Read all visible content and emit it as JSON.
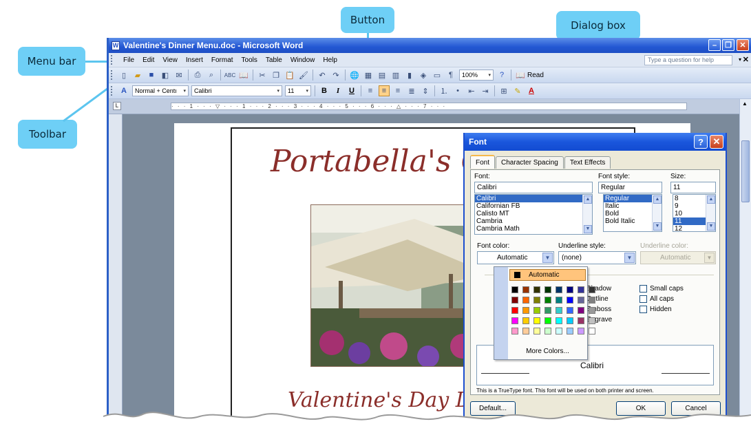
{
  "callouts": {
    "menu_bar": "Menu bar",
    "toolbar": "Toolbar",
    "button": "Button",
    "dialog_box": "Dialog box"
  },
  "window": {
    "title": "Valentine's Dinner Menu.doc - Microsoft Word",
    "minimize": "–",
    "restore": "❐",
    "close": "✕"
  },
  "menu": {
    "items": [
      "File",
      "Edit",
      "View",
      "Insert",
      "Format",
      "Tools",
      "Table",
      "Window",
      "Help"
    ],
    "help_placeholder": "Type a question for help"
  },
  "toolbar1": {
    "zoom": "100%",
    "read_label": "Read"
  },
  "toolbar2": {
    "style": "Normal + Centı",
    "font": "Calibri",
    "size": "11",
    "bold": "B",
    "italic": "I",
    "underline": "U"
  },
  "document": {
    "heading": "Portabella's Ga",
    "subheading": "Valentine's Day Di"
  },
  "dialog": {
    "title": "Font",
    "help": "?",
    "close": "✕",
    "tabs": [
      "Font",
      "Character Spacing",
      "Text Effects"
    ],
    "font_label": "Font:",
    "font_value": "Calibri",
    "font_list": [
      "Calibri",
      "Californian FB",
      "Calisto MT",
      "Cambria",
      "Cambria Math"
    ],
    "style_label": "Font style:",
    "style_value": "Regular",
    "style_list": [
      "Regular",
      "Italic",
      "Bold",
      "Bold Italic"
    ],
    "size_label": "Size:",
    "size_value": "11",
    "size_list": [
      "8",
      "9",
      "10",
      "11",
      "12"
    ],
    "font_color_label": "Font color:",
    "font_color_value": "Automatic",
    "underline_style_label": "Underline style:",
    "underline_style_value": "(none)",
    "underline_color_label": "Underline color:",
    "underline_color_value": "Automatic",
    "effects_col2": [
      "Shadow",
      "Outline",
      "Emboss",
      "Engrave"
    ],
    "effects_col3": [
      "Small caps",
      "All caps",
      "Hidden"
    ],
    "preview_text": "Calibri",
    "truetype_note": "This is a TrueType font. This font will be used on both printer and screen.",
    "default_button": "Default...",
    "ok_button": "OK",
    "cancel_button": "Cancel"
  },
  "palette": {
    "automatic": "Automatic",
    "more_colors": "More Colors...",
    "colors": [
      "#000000",
      "#993300",
      "#333300",
      "#003300",
      "#003366",
      "#000080",
      "#333399",
      "#333333",
      "#800000",
      "#ff6600",
      "#808000",
      "#008000",
      "#008080",
      "#0000ff",
      "#666699",
      "#808080",
      "#ff0000",
      "#ff9900",
      "#99cc00",
      "#339966",
      "#33cccc",
      "#3366ff",
      "#800080",
      "#999999",
      "#ff00ff",
      "#ffcc00",
      "#ffff00",
      "#00ff00",
      "#00ffff",
      "#00ccff",
      "#993366",
      "#c0c0c0",
      "#ff99cc",
      "#ffcc99",
      "#ffff99",
      "#ccffcc",
      "#ccffff",
      "#99ccff",
      "#cc99ff",
      "#ffffff"
    ]
  },
  "accent": "#6ecff6"
}
